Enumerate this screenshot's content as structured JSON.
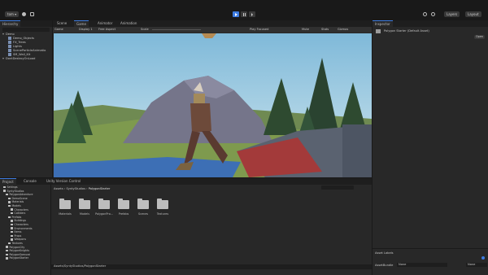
{
  "toolbar": {
    "account": "tom ▾",
    "play_icon": "play-icon",
    "pause_icon": "pause-icon",
    "step_icon": "step-icon",
    "layers": "Layers",
    "layout": "Layout"
  },
  "hierarchy": {
    "tab": "Hierarchy",
    "items": [
      "Demo",
      "Demo_Objects",
      "FX_Trees",
      "Lights",
      "SceneParticleAnimatio",
      "SM_Wall_Kit",
      "DontDestroyOnLoad"
    ]
  },
  "scene_tabs": {
    "scene": "Scene",
    "game": "Game",
    "animator": "Animator",
    "animation": "Animation"
  },
  "game_toolbar": {
    "display": "Game",
    "display_sel": "Display 1",
    "aspect": "Free Aspect",
    "scale_label": "Scale",
    "play_focused": "Play Focused",
    "mute": "Mute",
    "stats": "Stats",
    "gizmos": "Gizmos"
  },
  "bottom_tabs": {
    "project": "Project",
    "console": "Console",
    "unity_version_control": "Unity Version Control"
  },
  "project_tree": [
    "Settings",
    "SyntyStudios",
    "PolygonAdventure",
    "DemoScene",
    "Materials",
    "Models",
    "Characters",
    "Colliders",
    "Prefabs",
    "Buildings",
    "Characters",
    "Environments",
    "Items",
    "Props",
    "Weapons",
    "Textures",
    "PolygonCity",
    "PolygonKnights",
    "PolygonSamurai",
    "PolygonStarter"
  ],
  "breadcrumb": {
    "assets": "Assets",
    "synty": "SyntyStudios",
    "starter": "PolygonStarter"
  },
  "folders": [
    "Materials",
    "Models",
    "PolygonPro...",
    "Prefabs",
    "Scenes",
    "Textures"
  ],
  "status_path": "Assets/SyntyStudios/PolygonStarter",
  "inspector": {
    "tab": "Inspector",
    "title": "Polygon Starter (Default Asset)",
    "open": "Open",
    "asset_labels": "Asset Labels",
    "asset_bundle": "AssetBundle",
    "bundle_value": "None",
    "variant_value": "None"
  },
  "colors": {
    "accent": "#3d7be0",
    "sky": "#8bc5e0"
  }
}
